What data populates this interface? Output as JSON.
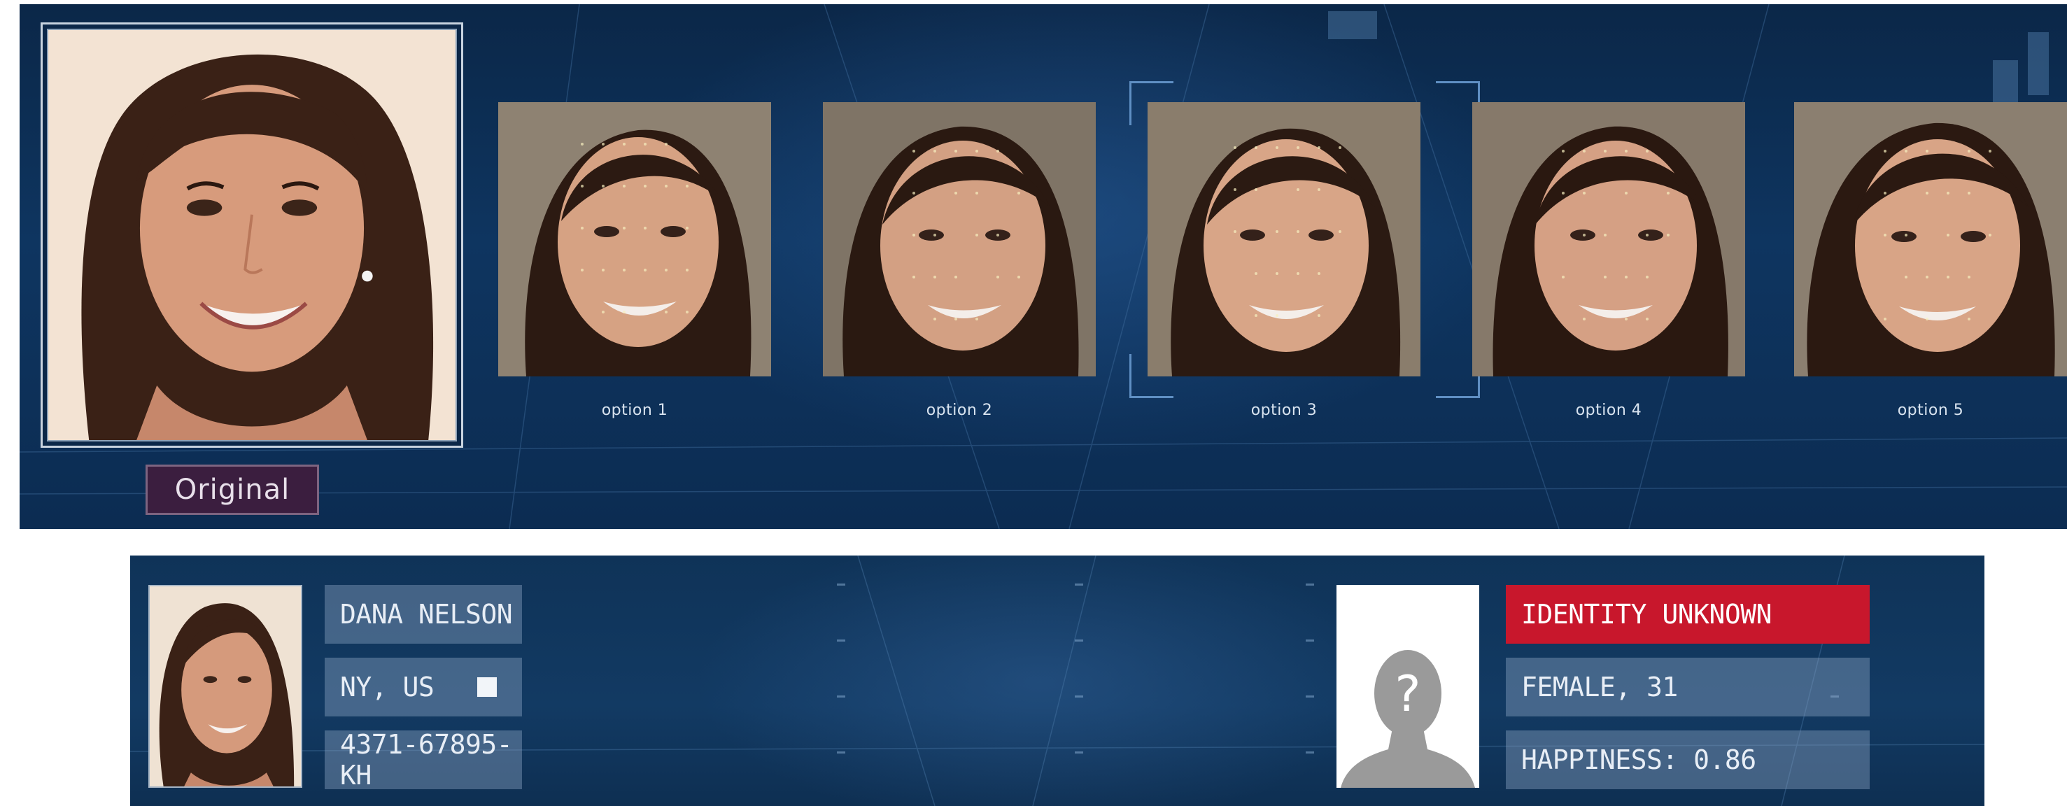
{
  "top": {
    "original_label": "Original",
    "options": [
      "option 1",
      "option 2",
      "option 3",
      "option 4",
      "option 5"
    ],
    "selected_option_index": 2
  },
  "profile": {
    "name": "DANA NELSON",
    "location": "NY, US",
    "id": "4371-67895-KH"
  },
  "unknown": {
    "status": "IDENTITY UNKNOWN",
    "demographics": "FEMALE, 31",
    "happiness": "HAPPINESS: 0.86",
    "avatar_glyph": "?"
  },
  "colors": {
    "panel_bg": "#0e3560",
    "alert_red": "#c8172c",
    "label_bg": "#3b1e3f"
  }
}
